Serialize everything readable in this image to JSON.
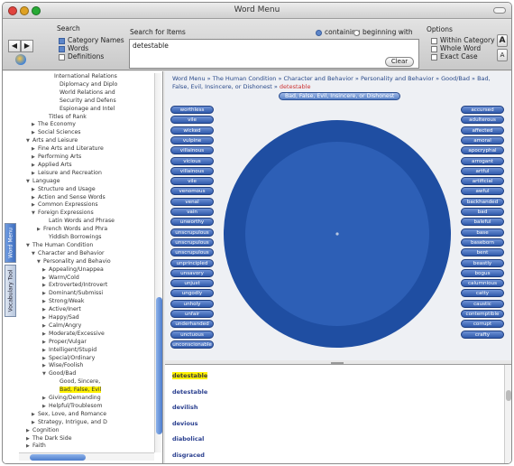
{
  "window": {
    "title": "Word Menu"
  },
  "toolbar": {
    "search_label": "Search",
    "search_for_label": "Search for Items",
    "search_value": "detestable",
    "opt_category_names": "Category Names",
    "opt_words": "Words",
    "opt_definitions": "Definitions",
    "mode_containing": "containing",
    "mode_beginning": "beginning with",
    "options_label": "Options",
    "opt_within_category": "Within Category",
    "opt_whole_word": "Whole Word",
    "opt_exact_case": "Exact Case",
    "clear_label": "Clear",
    "back_glyph": "◀",
    "forward_glyph": "▶",
    "big_a": "A",
    "small_a": "A"
  },
  "sidebar": {
    "tab_top": "Word Menu",
    "tab_vocab": "Vocabulary Tool",
    "tree": [
      {
        "label": "International Relations",
        "indent": 5,
        "arrow": ""
      },
      {
        "label": "Diplomacy and Diplo",
        "indent": 6,
        "arrow": ""
      },
      {
        "label": "World Relations and",
        "indent": 6,
        "arrow": ""
      },
      {
        "label": "Security and Defens",
        "indent": 6,
        "arrow": ""
      },
      {
        "label": "Espionage and Intel",
        "indent": 6,
        "arrow": ""
      },
      {
        "label": "Titles of Rank",
        "indent": 4,
        "arrow": ""
      },
      {
        "label": "The Economy",
        "indent": 2,
        "arrow": "▶"
      },
      {
        "label": "Social Sciences",
        "indent": 2,
        "arrow": "▶"
      },
      {
        "label": "Arts and Leisure",
        "indent": 1,
        "arrow": "▼"
      },
      {
        "label": "Fine Arts and Literature",
        "indent": 2,
        "arrow": "▶"
      },
      {
        "label": "Performing Arts",
        "indent": 2,
        "arrow": "▶"
      },
      {
        "label": "Applied Arts",
        "indent": 2,
        "arrow": "▶"
      },
      {
        "label": "Leisure and Recreation",
        "indent": 2,
        "arrow": "▶"
      },
      {
        "label": "Language",
        "indent": 1,
        "arrow": "▼"
      },
      {
        "label": "Structure and Usage",
        "indent": 2,
        "arrow": "▶"
      },
      {
        "label": "Action and Sense Words",
        "indent": 2,
        "arrow": "▶"
      },
      {
        "label": "Common Expressions",
        "indent": 2,
        "arrow": "▶"
      },
      {
        "label": "Foreign Expressions",
        "indent": 2,
        "arrow": "▼"
      },
      {
        "label": "Latin Words and Phrase",
        "indent": 4,
        "arrow": ""
      },
      {
        "label": "French Words and Phra",
        "indent": 3,
        "arrow": "▶"
      },
      {
        "label": "Yiddish Borrowings",
        "indent": 4,
        "arrow": ""
      },
      {
        "label": "The Human Condition",
        "indent": 1,
        "arrow": "▼"
      },
      {
        "label": "Character and Behavior",
        "indent": 2,
        "arrow": "▼"
      },
      {
        "label": "Personality and Behavio",
        "indent": 3,
        "arrow": "▼"
      },
      {
        "label": "Appealing/Unappea",
        "indent": 4,
        "arrow": "▶"
      },
      {
        "label": "Warm/Cold",
        "indent": 4,
        "arrow": "▶"
      },
      {
        "label": "Extroverted/Introvert",
        "indent": 4,
        "arrow": "▶"
      },
      {
        "label": "Dominant/Submissi",
        "indent": 4,
        "arrow": "▶"
      },
      {
        "label": "Strong/Weak",
        "indent": 4,
        "arrow": "▶"
      },
      {
        "label": "Active/Inert",
        "indent": 4,
        "arrow": "▶"
      },
      {
        "label": "Happy/Sad",
        "indent": 4,
        "arrow": "▶"
      },
      {
        "label": "Calm/Angry",
        "indent": 4,
        "arrow": "▶"
      },
      {
        "label": "Moderate/Excessive",
        "indent": 4,
        "arrow": "▶"
      },
      {
        "label": "Proper/Vulgar",
        "indent": 4,
        "arrow": "▶"
      },
      {
        "label": "Intelligent/Stupid",
        "indent": 4,
        "arrow": "▶"
      },
      {
        "label": "Special/Ordinary",
        "indent": 4,
        "arrow": "▶"
      },
      {
        "label": "Wise/Foolish",
        "indent": 4,
        "arrow": "▶"
      },
      {
        "label": "Good/Bad",
        "indent": 4,
        "arrow": "▼"
      },
      {
        "label": "Good, Sincere,",
        "indent": 6,
        "arrow": ""
      },
      {
        "label": "Bad, False, Evil",
        "indent": 6,
        "arrow": "",
        "highlight": true
      },
      {
        "label": "Giving/Demanding",
        "indent": 4,
        "arrow": "▶"
      },
      {
        "label": "Helpful/Troublesom",
        "indent": 4,
        "arrow": "▶"
      },
      {
        "label": "Sex, Love, and Romance",
        "indent": 2,
        "arrow": "▶"
      },
      {
        "label": "Strategy, Intrigue, and D",
        "indent": 2,
        "arrow": "▶"
      },
      {
        "label": "Cognition",
        "indent": 1,
        "arrow": "▶"
      },
      {
        "label": "The Dark Side",
        "indent": 1,
        "arrow": "▶"
      },
      {
        "label": "Faith",
        "indent": 1,
        "arrow": "▶"
      }
    ]
  },
  "main": {
    "breadcrumb_path": "Word Menu  »  The Human Condition  »  Character and Behavior  »  Personality and Behavior  »  Good/Bad  »  Bad, False, Evil, Insincere, or Dishonest  »",
    "breadcrumb_current": "detestable",
    "header_pill": "Bad, False, Evil, Insincere, or Dishonest",
    "left_words": [
      "worthless",
      "vile",
      "wicked",
      "vulpine",
      "villainous",
      "vicious",
      "villainous",
      "vile",
      "venomous",
      "venal",
      "vain",
      "unworthy",
      "unscrupulous",
      "unscrupulous",
      "unscrupulous",
      "unprincipled",
      "unsavory",
      "unjust",
      "ungodly",
      "unholy",
      "unfair",
      "underhanded",
      "unctuous",
      "unconscionable"
    ],
    "right_words": [
      "accursed",
      "adulterous",
      "affected",
      "amoral",
      "apocryphal",
      "arrogant",
      "artful",
      "artificial",
      "awful",
      "backhanded",
      "bad",
      "baleful",
      "base",
      "baseborn",
      "bent",
      "beastly",
      "bogus",
      "calumnious",
      "catty",
      "caustic",
      "contemptible",
      "corrupt",
      "crafty"
    ],
    "center_dot": "•"
  },
  "list": {
    "items": [
      "detestable",
      "detestable",
      "devilish",
      "devious",
      "diabolical",
      "disgraced"
    ]
  },
  "colors": {
    "circle_outer": "#1f4ea2",
    "circle_inner": "#2d5fb6",
    "word_button": "#3c64b4",
    "highlight": "#fff200"
  }
}
